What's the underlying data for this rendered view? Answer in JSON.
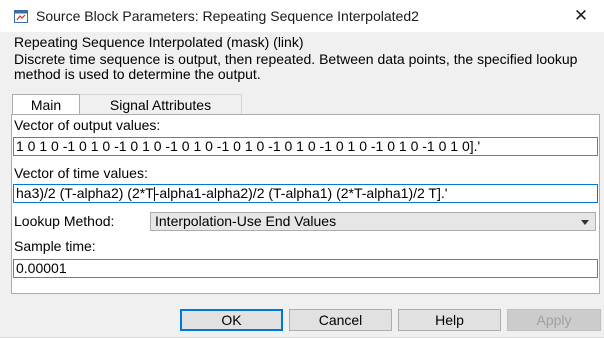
{
  "window": {
    "title": "Source Block Parameters: Repeating Sequence Interpolated2",
    "close_glyph": "✕"
  },
  "description": {
    "heading": "Repeating Sequence Interpolated (mask) (link)",
    "text": "Discrete time sequence is output, then repeated.  Between data points, the specified lookup method is used to determine the output."
  },
  "tabs": [
    {
      "label": "Main",
      "selected": true
    },
    {
      "label": "Signal Attributes",
      "selected": false
    }
  ],
  "main": {
    "output_values_label": "Vector of output values:",
    "output_values": "1 0 1  0 -1 0 1  0 -1 0 1  0 -1 0 1  0 -1 0 1  0 -1 0 1  0 -1 0 1  0 -1 0 1  0 -1 0 1 0].'",
    "time_values_label": "Vector of time values:",
    "time_values_before_caret": "ha3)/2 (T-alpha2) (2*T",
    "time_values_after_caret": "-alpha1-alpha2)/2 (T-alpha1) (2*T-alpha1)/2 T].'",
    "lookup_label": "Lookup Method:",
    "lookup_value": "Interpolation-Use End Values",
    "sample_time_label": "Sample time:",
    "sample_time": "0.00001"
  },
  "buttons": {
    "ok": "OK",
    "cancel": "Cancel",
    "help": "Help",
    "apply": "Apply"
  },
  "colors": {
    "focus_blue": "#0078d7",
    "dialog_bg": "#f0f0f0"
  }
}
